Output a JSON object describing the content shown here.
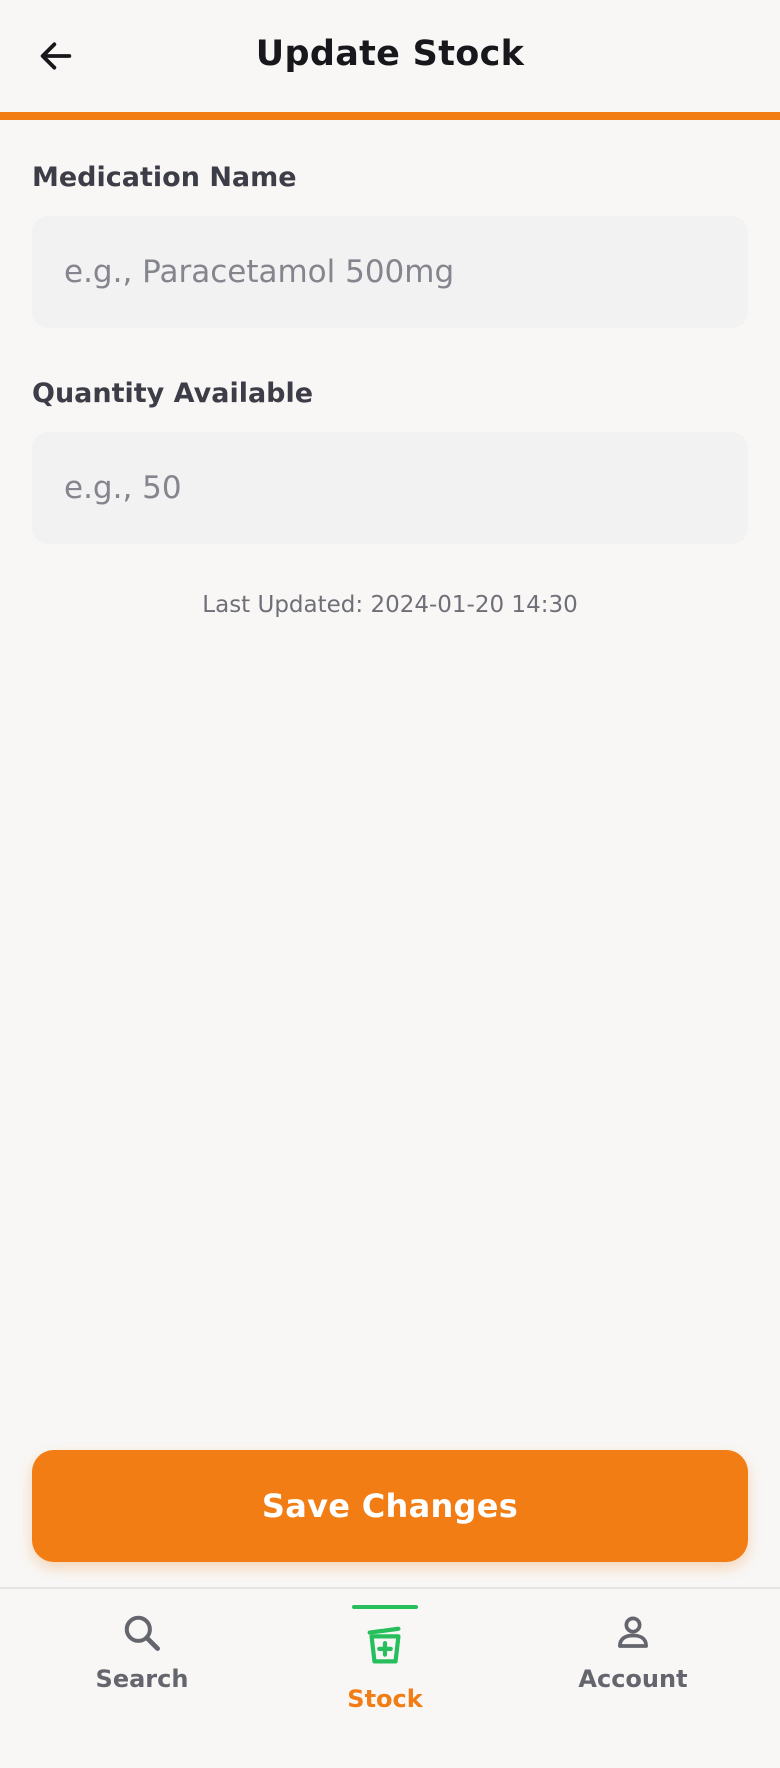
{
  "header": {
    "title": "Update Stock",
    "back_icon": "arrow-left-icon"
  },
  "form": {
    "medication": {
      "label": "Medication Name",
      "placeholder": "e.g., Paracetamol 500mg",
      "value": ""
    },
    "quantity": {
      "label": "Quantity Available",
      "placeholder": "e.g., 50",
      "value": ""
    },
    "last_updated": "Last Updated: 2024-01-20 14:30"
  },
  "actions": {
    "save_label": "Save Changes"
  },
  "nav": {
    "items": [
      {
        "label": "Search",
        "icon": "search-icon",
        "active": false
      },
      {
        "label": "Stock",
        "icon": "medicine-mortar-icon",
        "active": true
      },
      {
        "label": "Account",
        "icon": "person-icon",
        "active": false
      }
    ]
  },
  "colors": {
    "accent": "#f27d14",
    "active_nav_icon": "#27bf5c",
    "background": "#f8f7f6",
    "input_background": "#f2f2f3",
    "inactive_nav": "#65656e"
  }
}
